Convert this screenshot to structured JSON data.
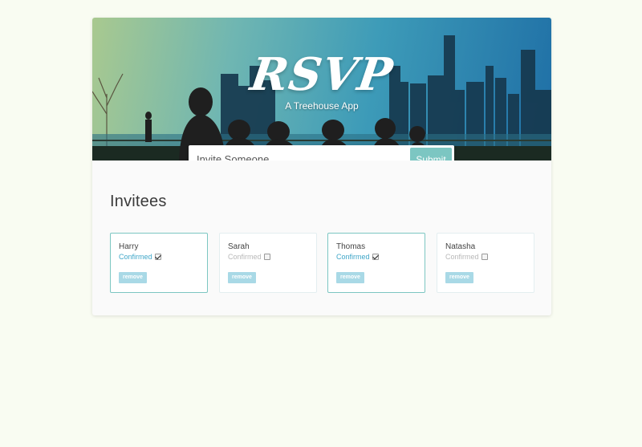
{
  "header": {
    "logo": "RSVP",
    "tagline": "A Treehouse App"
  },
  "invite_form": {
    "placeholder": "Invite Someone",
    "submit_label": "Submit"
  },
  "invitees_section": {
    "title": "Invitees",
    "invitees": [
      {
        "name": "Harry",
        "confirm_label": "Confirmed",
        "confirmed": true,
        "remove_label": "remove"
      },
      {
        "name": "Sarah",
        "confirm_label": "Confirmed",
        "confirmed": false,
        "remove_label": "remove"
      },
      {
        "name": "Thomas",
        "confirm_label": "Confirmed",
        "confirmed": true,
        "remove_label": "remove"
      },
      {
        "name": "Natasha",
        "confirm_label": "Confirmed",
        "confirmed": false,
        "remove_label": "remove"
      }
    ]
  },
  "colors": {
    "page_background": "#f9fcf2",
    "accent": "#7cc6c2",
    "confirmed_text": "#3fa6c8",
    "remove_button": "#a9d9e6"
  }
}
